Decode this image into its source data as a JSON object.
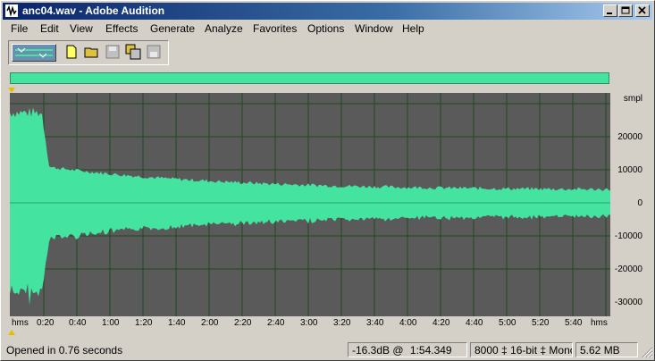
{
  "window": {
    "title": "anc04.wav - Adobe Audition"
  },
  "menu": [
    "File",
    "Edit",
    "View",
    "Effects",
    "Generate",
    "Analyze",
    "Favorites",
    "Options",
    "Window",
    "Help"
  ],
  "toolbar": {
    "icons": [
      "waveform-mode-icon",
      "new-file-icon",
      "open-file-icon",
      "save-icon",
      "save-all-icon",
      "save-selection-icon"
    ]
  },
  "scale": {
    "unit": "smpl",
    "labels": [
      "20000",
      "10000",
      "0",
      "-10000",
      "-20000",
      "-30000"
    ]
  },
  "timeline": {
    "unit_left": "hms",
    "unit_right": "hms",
    "labels": [
      "0:20",
      "0:40",
      "1:00",
      "1:20",
      "1:40",
      "2:00",
      "2:20",
      "2:40",
      "3:00",
      "3:20",
      "3:40",
      "4:00",
      "4:20",
      "4:40",
      "5:00",
      "5:20",
      "5:40"
    ]
  },
  "status": {
    "message": "Opened in 0.76 seconds",
    "level": "-16.3dB @",
    "position": "1:54.349",
    "format": "8000 ‡ 16-bit ‡ Mono",
    "size": "5.62 MB"
  },
  "colors": {
    "waveform": "#45e3a0",
    "background": "#5a5a5a",
    "grid": "#1f4a1f",
    "title_start": "#0a246a",
    "title_end": "#a6caf0"
  }
}
